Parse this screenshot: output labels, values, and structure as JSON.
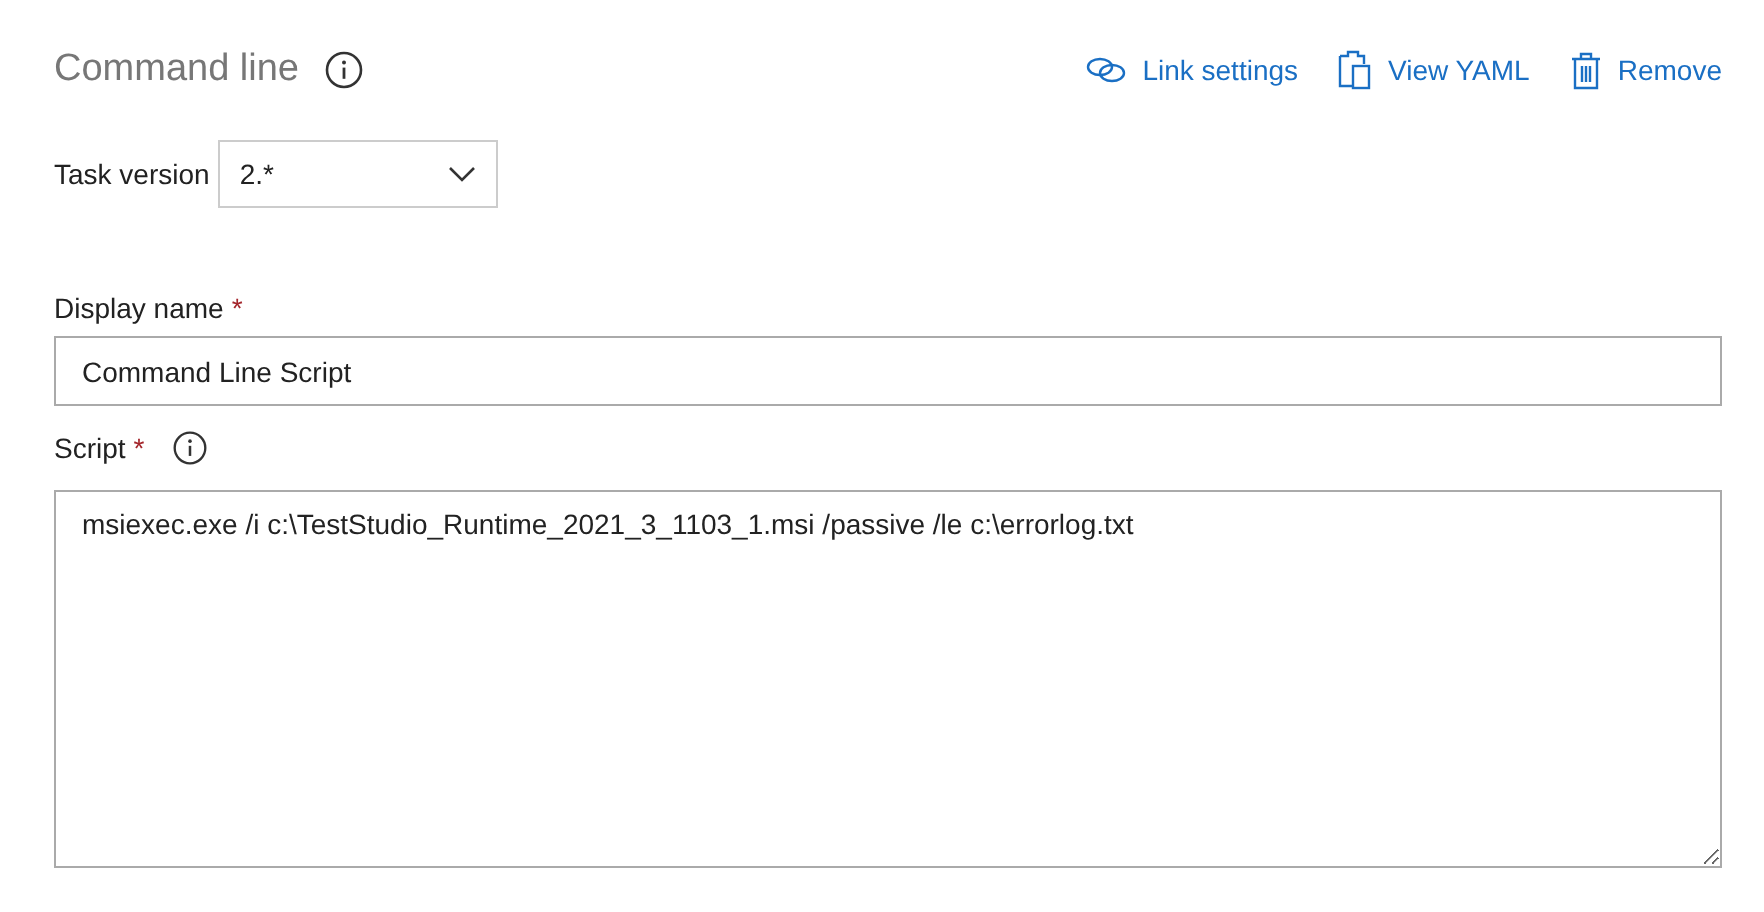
{
  "header": {
    "title": "Command line",
    "actions": [
      {
        "kind": "link",
        "label": "Link settings"
      },
      {
        "kind": "yaml",
        "label": "View YAML"
      },
      {
        "kind": "remove",
        "label": "Remove"
      }
    ]
  },
  "task_version": {
    "label": "Task version",
    "value": "2.*"
  },
  "display_name": {
    "label": "Display name",
    "required_mark": "*",
    "value": "Command Line Script"
  },
  "script": {
    "label": "Script",
    "required_mark": "*",
    "value": "msiexec.exe /i c:\\TestStudio_Runtime_2021_3_1103_1.msi /passive /le c:\\errorlog.txt"
  }
}
